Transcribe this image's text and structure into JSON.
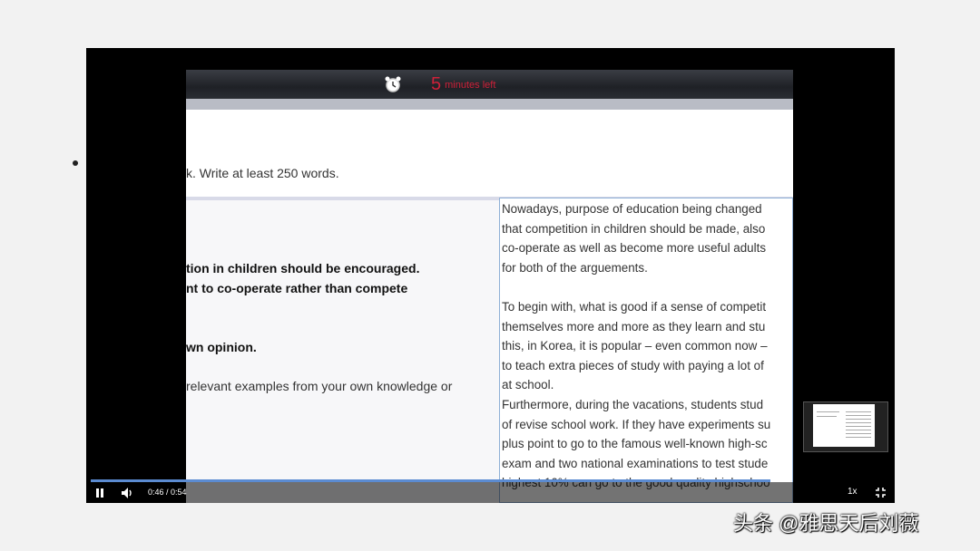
{
  "exam": {
    "timer_number": "5",
    "timer_suffix": "minutes left",
    "instruction": "k. Write at least 250 words.",
    "task_lines": [
      "tion in children should be encouraged.",
      "nt to co-operate rather than compete",
      "wn opinion.",
      "relevant examples from your own knowledge or"
    ]
  },
  "essay": {
    "lines": [
      "Nowadays, purpose of education being changed",
      "that competition in children should be made, also",
      "co-operate as well as become more useful adults",
      "for both of the arguements.",
      "",
      "To begin with, what is good if a sense of competit",
      "themselves more and more as they learn and stu",
      "this, in Korea, it is popular – even common now –",
      "to teach extra pieces of study with paying a lot of",
      "at school.",
      "Furthermore, during the vacations, students stud",
      "of revise school work. If they have experiments su",
      "plus point to go to the famous well-known high-sc",
      "exam and two national examinations to test stude",
      "highest 10% can go to the good quality highschoo"
    ]
  },
  "player": {
    "time": "0:46 / 0:54",
    "speed": "1x",
    "progress": 0.85,
    "icons": [
      "pause-icon",
      "volume-icon",
      "fullscreen-icon",
      "alarm-clock-icon",
      "mouse-cursor-icon"
    ]
  },
  "watermark": "头条 @雅思天后刘薇"
}
